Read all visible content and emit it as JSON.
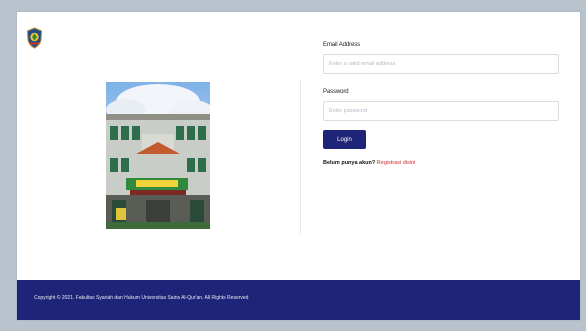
{
  "login": {
    "email_label": "Email Address",
    "email_placeholder": "Enter a valid email address",
    "password_label": "Password",
    "password_placeholder": "Enter password",
    "login_button": "Login",
    "register_prompt": "Belum punya akun?",
    "register_link": "Registrasi disini"
  },
  "footer": {
    "copyright": "Copyright © 2021. Fakultas Syariah dan Hukum Universitas Sains Al-Qur'an. All Rights Reserved"
  },
  "colors": {
    "primary": "#1e2477",
    "link": "#d12b2b",
    "background": "#b9c3ce"
  }
}
